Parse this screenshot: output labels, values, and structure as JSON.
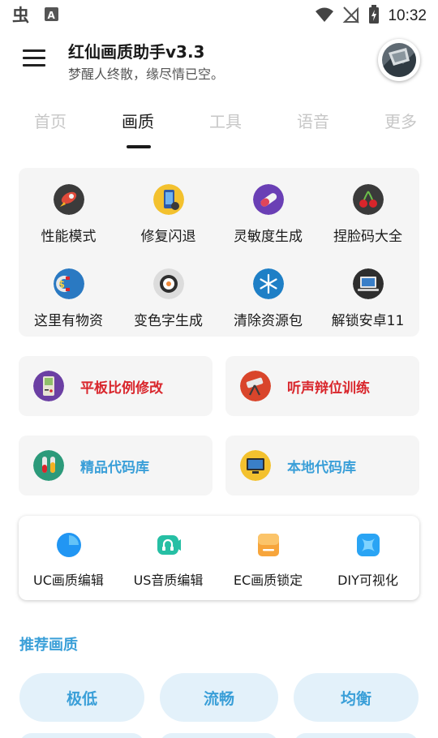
{
  "status_bar": {
    "time": "10:32",
    "left_icons": [
      "bug-icon",
      "a-badge-icon"
    ],
    "right_icons": [
      "wifi-icon",
      "no-signal-icon",
      "battery-charging-icon"
    ]
  },
  "header": {
    "title": "红仙画质助手v3.3",
    "subtitle": "梦醒人终散，缘尽情已空。"
  },
  "tabs": [
    {
      "label": "首页",
      "active": false
    },
    {
      "label": "画质",
      "active": true
    },
    {
      "label": "工具",
      "active": false
    },
    {
      "label": "语音",
      "active": false
    },
    {
      "label": "更多",
      "active": false
    }
  ],
  "grid": [
    {
      "label": "性能模式",
      "icon": "rocket-icon"
    },
    {
      "label": "修复闪退",
      "icon": "phone-repair-icon"
    },
    {
      "label": "灵敏度生成",
      "icon": "capsule-icon"
    },
    {
      "label": "捏脸码大全",
      "icon": "cherry-icon"
    },
    {
      "label": "这里有物资",
      "icon": "money-magnet-icon"
    },
    {
      "label": "变色字生成",
      "icon": "sushi-icon"
    },
    {
      "label": "清除资源包",
      "icon": "snowflake-icon"
    },
    {
      "label": "解锁安卓11",
      "icon": "laptop-icon"
    }
  ],
  "features": [
    {
      "label": "平板比例修改",
      "color": "#d9262c",
      "icon": "gameboy-icon"
    },
    {
      "label": "听声辩位训练",
      "color": "#d9262c",
      "icon": "telescope-icon"
    },
    {
      "label": "精品代码库",
      "color": "#3a9fd8",
      "icon": "test-tubes-icon"
    },
    {
      "label": "本地代码库",
      "color": "#3a9fd8",
      "icon": "monitor-icon"
    }
  ],
  "editors": [
    {
      "label": "UC画质编辑",
      "icon": "leaf-circle-icon",
      "color": "#2196f3"
    },
    {
      "label": "US音质编辑",
      "icon": "headphone-icon",
      "color": "#26bfa4"
    },
    {
      "label": "EC画质锁定",
      "icon": "document-icon",
      "color": "#f7a53b"
    },
    {
      "label": "DIY可视化",
      "icon": "puzzle-icon",
      "color": "#2aa4f4"
    }
  ],
  "recommend": {
    "title": "推荐画质",
    "options": [
      "极低",
      "流畅",
      "均衡"
    ]
  }
}
